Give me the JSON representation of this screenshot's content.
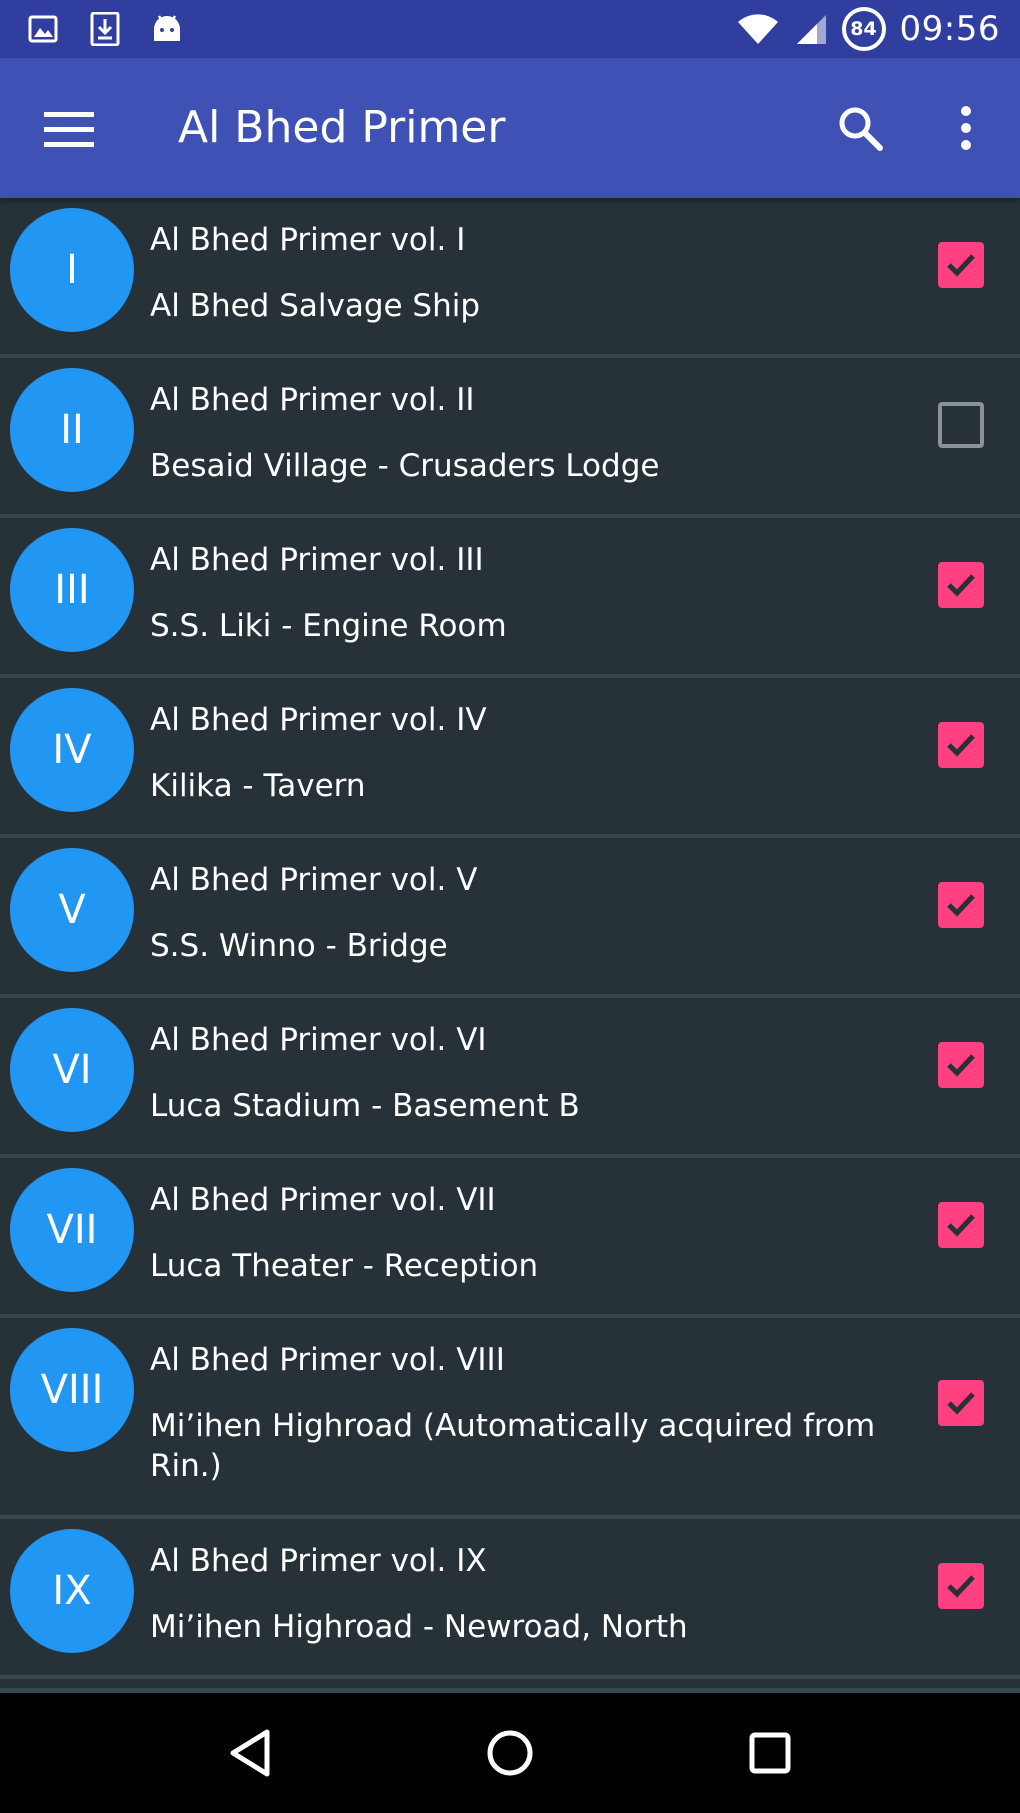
{
  "status_bar": {
    "time": "09:56",
    "battery_level": "84",
    "icons": [
      "image-icon",
      "download-icon",
      "android-icon",
      "wifi-icon",
      "signal-icon",
      "battery-icon"
    ]
  },
  "app_bar": {
    "title": "Al Bhed Primer",
    "color": "#3f51b5"
  },
  "primers": [
    {
      "numeral": "I",
      "title": "Al Bhed Primer vol. I",
      "location": "Al Bhed Salvage Ship",
      "checked": true
    },
    {
      "numeral": "II",
      "title": "Al Bhed Primer vol. II",
      "location": "Besaid Village - Crusaders Lodge",
      "checked": false
    },
    {
      "numeral": "III",
      "title": "Al Bhed Primer vol. III",
      "location": "S.S. Liki - Engine Room",
      "checked": true
    },
    {
      "numeral": "IV",
      "title": "Al Bhed Primer vol. IV",
      "location": "Kilika - Tavern",
      "checked": true
    },
    {
      "numeral": "V",
      "title": "Al Bhed Primer vol. V",
      "location": "S.S. Winno - Bridge",
      "checked": true
    },
    {
      "numeral": "VI",
      "title": "Al Bhed Primer vol. VI",
      "location": "Luca Stadium - Basement B",
      "checked": true
    },
    {
      "numeral": "VII",
      "title": "Al Bhed Primer vol. VII",
      "location": "Luca Theater - Reception",
      "checked": true
    },
    {
      "numeral": "VIII",
      "title": "Al Bhed Primer vol. VIII",
      "location": "Mi’ihen Highroad (Automatically acquired from Rin.)",
      "checked": true
    },
    {
      "numeral": "IX",
      "title": "Al Bhed Primer vol. IX",
      "location": "Mi’ihen Highroad - Newroad, North",
      "checked": true
    }
  ],
  "colors": {
    "accent": "#ff4081",
    "avatar": "#2196f3",
    "background": "#263238",
    "divider": "#37474f"
  }
}
